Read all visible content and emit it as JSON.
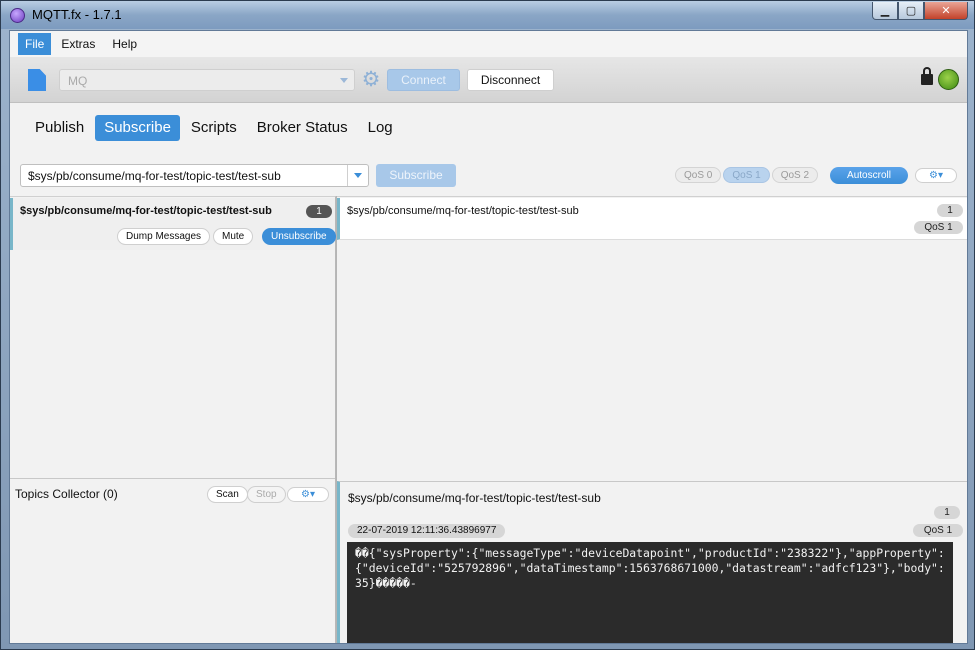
{
  "window": {
    "title": "MQTT.fx - 1.7.1"
  },
  "menu": {
    "items": [
      "File",
      "Extras",
      "Help"
    ]
  },
  "toolbar": {
    "profile_value": "MQ",
    "connect_label": "Connect",
    "disconnect_label": "Disconnect"
  },
  "tabs": [
    "Publish",
    "Subscribe",
    "Scripts",
    "Broker Status",
    "Log"
  ],
  "subscribe_bar": {
    "topic_value": "$sys/pb/consume/mq-for-test/topic-test/test-sub",
    "subscribe_label": "Subscribe",
    "qos": [
      "QoS 0",
      "QoS 1",
      "QoS 2"
    ],
    "autoscroll_label": "Autoscroll",
    "gear_glyph": "⚙▾"
  },
  "subscriptions": [
    {
      "topic": "$sys/pb/consume/mq-for-test/topic-test/test-sub",
      "count": "1",
      "dump_label": "Dump Messages",
      "mute_label": "Mute",
      "unsubscribe_label": "Unsubscribe"
    }
  ],
  "topics_collector": {
    "title": "Topics Collector (0)",
    "scan_label": "Scan",
    "stop_label": "Stop",
    "gear_glyph": "⚙▾"
  },
  "messages": [
    {
      "topic": "$sys/pb/consume/mq-for-test/topic-test/test-sub",
      "count": "1",
      "qos": "QoS 1"
    }
  ],
  "detail": {
    "topic": "$sys/pb/consume/mq-for-test/topic-test/test-sub",
    "count": "1",
    "timestamp": "22-07-2019  12:11:36.43896977",
    "qos": "QoS 1",
    "payload": "��{\"sysProperty\":{\"messageType\":\"deviceDatapoint\",\"productId\":\"238322\"},\"appProperty\":{\"deviceId\":\"525792896\",\"dataTimestamp\":1563768671000,\"datastream\":\"adfcf123\"},\"body\":35}�����-"
  },
  "colors": {
    "accent": "#3b8ed8",
    "status_connected": "#5cae2a"
  },
  "icons": {
    "app": "mqttfx-app-icon",
    "profile": "document-icon",
    "settings": "gear-icon",
    "lock": "lock-icon",
    "status": "connection-status-icon"
  }
}
